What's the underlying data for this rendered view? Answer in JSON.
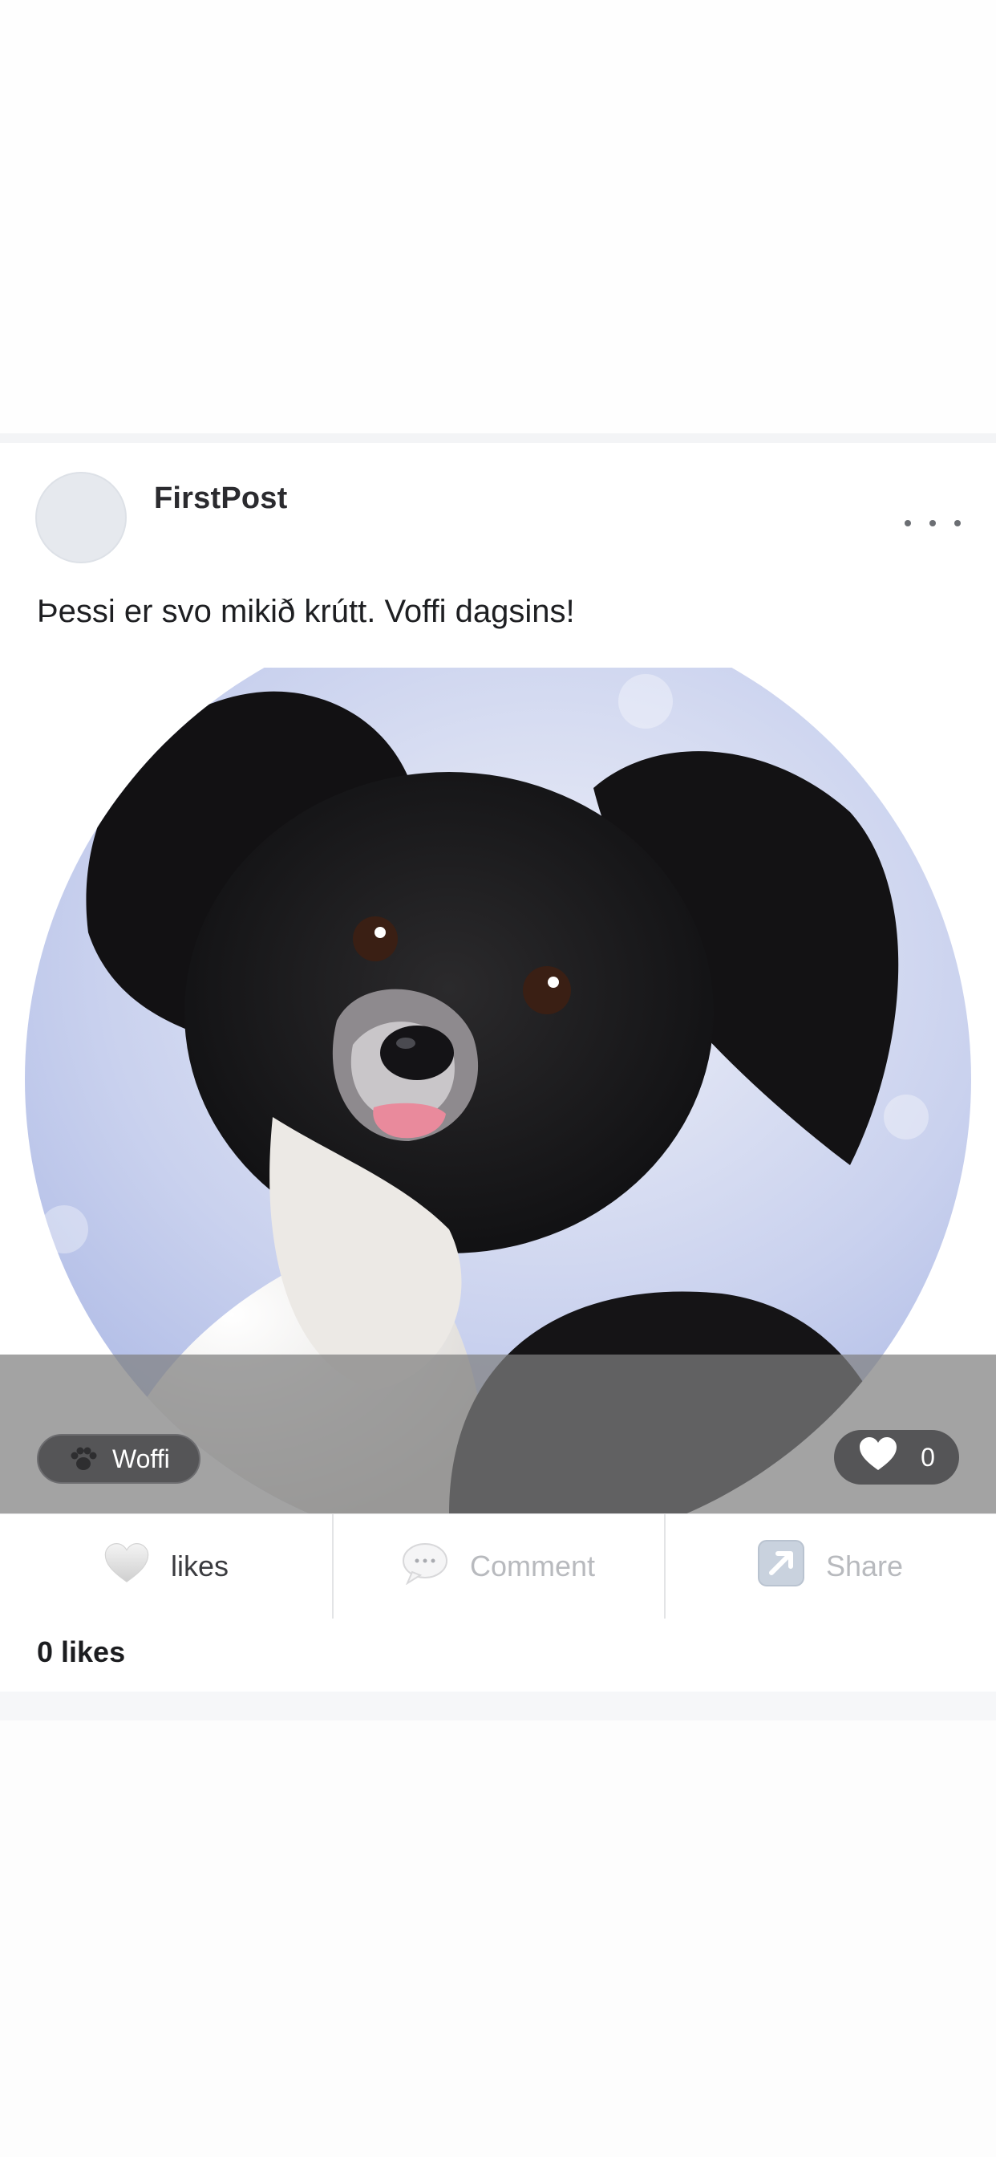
{
  "post": {
    "author": "FirstPost",
    "caption": "Þessi er svo mikið krútt. Voffi dagsins!",
    "tag": "Woffi",
    "like_badge_count": "0",
    "image": "black-and-white-papillon-dog-photo"
  },
  "actions": {
    "likes_label": "likes",
    "comment_label": "Comment",
    "share_label": "Share"
  },
  "likes_summary": "0 likes",
  "icons": {
    "more": "more-horizontal-icon",
    "paw": "paw-icon",
    "heart": "heart-icon",
    "comment": "speech-bubble-icon",
    "share": "share-arrow-icon"
  },
  "colors": {
    "overlay": "#808080",
    "pill": "#555557",
    "muted_text": "#b8babe"
  }
}
